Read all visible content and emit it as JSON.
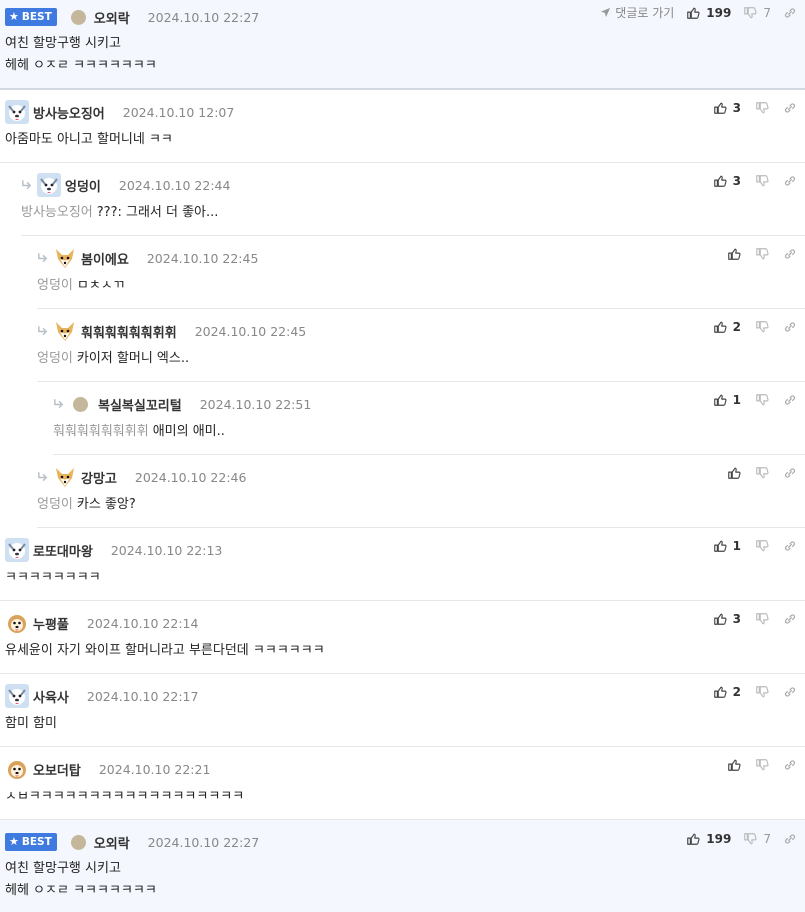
{
  "best_top": {
    "badge": "BEST",
    "nick": "오외락",
    "date": "2024.10.10 22:27",
    "goto": "댓글로 가기",
    "likes": "199",
    "dislikes": "7",
    "lines": [
      "여친 할망구행 시키고",
      "헤헤 ㅇㅈㄹ ㅋㅋㅋㅋㅋㅋㅋ"
    ]
  },
  "comments": [
    {
      "nick": "방사능오징어",
      "date": "2024.10.10 12:07",
      "likes": "3",
      "mention": "",
      "text": "아줌마도 아니고 할머니네 ㅋㅋ",
      "avatar": "husky"
    },
    {
      "nick": "엉덩이",
      "date": "2024.10.10 22:44",
      "likes": "3",
      "mention": "방사능오징어",
      "text": "???: 그래서 더 좋아...",
      "avatar": "husky"
    },
    {
      "nick": "봄이에요",
      "date": "2024.10.10 22:45",
      "likes": "",
      "mention": "엉덩이",
      "text": "ㅁㅊㅅㄲ",
      "avatar": "fox"
    },
    {
      "nick": "훠훠훠훠훠훠휘휘",
      "date": "2024.10.10 22:45",
      "likes": "2",
      "mention": "엉덩이",
      "text": "카이저 할머니 엑스..",
      "avatar": "fox"
    },
    {
      "nick": "복실복실꼬리털",
      "date": "2024.10.10 22:51",
      "likes": "1",
      "mention": "훠훠훠훠훠훠휘휘",
      "text": "애미의 애미..",
      "avatar": "dot"
    },
    {
      "nick": "강망고",
      "date": "2024.10.10 22:46",
      "likes": "",
      "mention": "엉덩이",
      "text": "카스 좋앙?",
      "avatar": "fox"
    },
    {
      "nick": "로또대마왕",
      "date": "2024.10.10 22:13",
      "likes": "1",
      "mention": "",
      "text": "ㅋㅋㅋㅋㅋㅋㅋㅋ",
      "avatar": "husky"
    },
    {
      "nick": "누평풀",
      "date": "2024.10.10 22:14",
      "likes": "3",
      "mention": "",
      "text": "유세윤이 자기 와이프 할머니라고 부른다던데 ㅋㅋㅋㅋㅋㅋ",
      "avatar": "pup"
    },
    {
      "nick": "사육사",
      "date": "2024.10.10 22:17",
      "likes": "2",
      "mention": "",
      "text": "함미 함미",
      "avatar": "husky"
    },
    {
      "nick": "오보더탑",
      "date": "2024.10.10 22:21",
      "likes": "",
      "mention": "",
      "text": "ㅅㅂㅋㅋㅋㅋㅋㅋㅋㅋㅋㅋㅋㅋㅋㅋㅋㅋㅋㅋ",
      "avatar": "pup"
    }
  ],
  "best_bottom": {
    "badge": "BEST",
    "nick": "오외락",
    "date": "2024.10.10 22:27",
    "likes": "199",
    "dislikes": "7",
    "lines": [
      "여친 할망구행 시키고",
      "헤헤 ㅇㅈㄹ ㅋㅋㅋㅋㅋㅋㅋ"
    ]
  },
  "colors": {
    "accent": "#3f7ae0",
    "best_bg": "#f4f7fd",
    "mention": "#999999"
  },
  "icons": {
    "like": "thumbs-up-icon",
    "dislike": "thumbs-down-icon",
    "link": "link-icon",
    "reply": "reply-arrow-icon",
    "star": "star-icon",
    "goto": "navigation-arrow-icon"
  }
}
